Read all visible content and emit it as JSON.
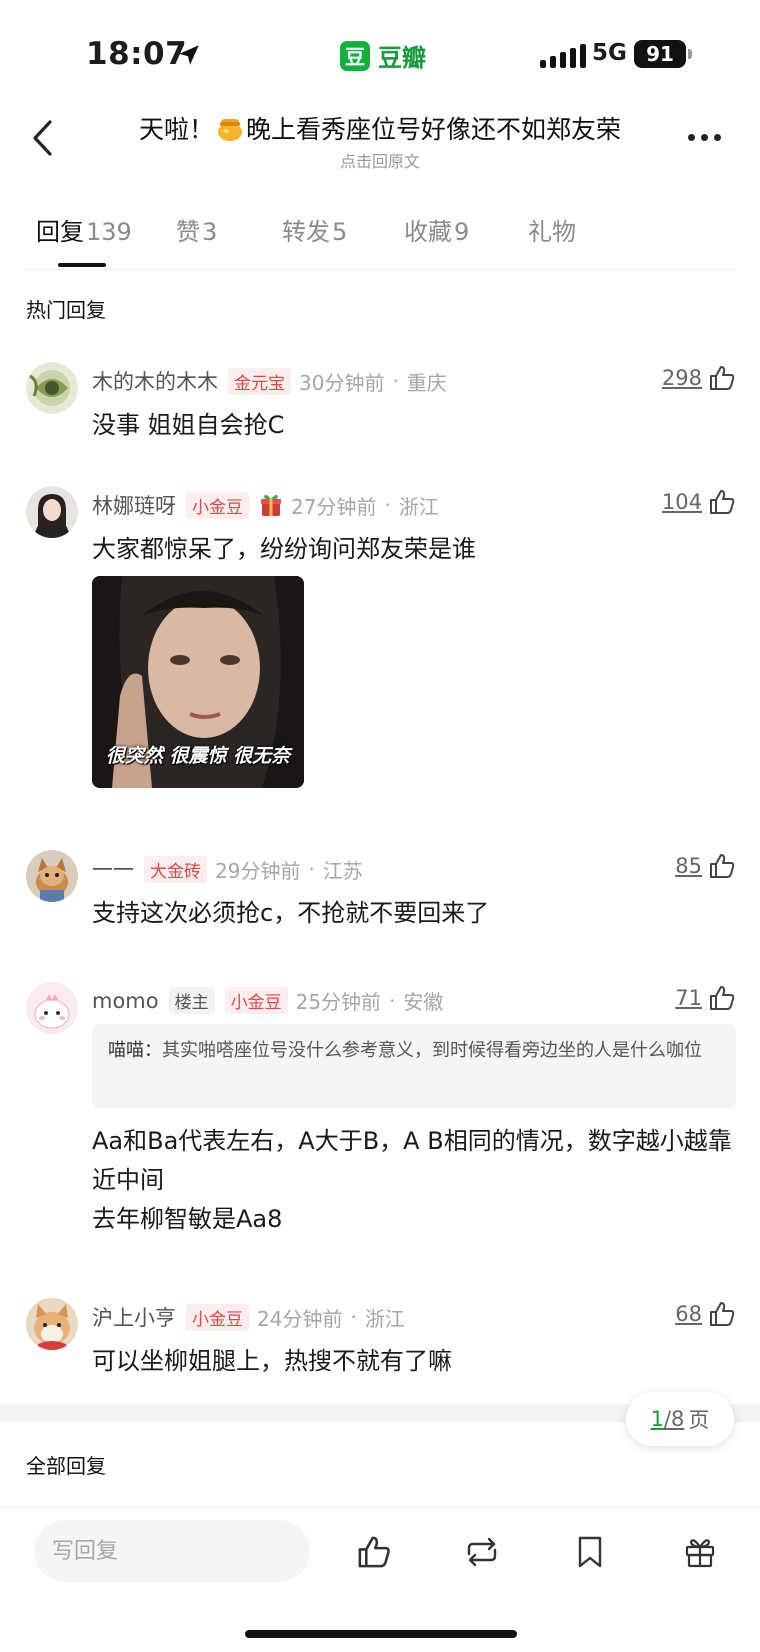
{
  "status_bar": {
    "time": "18:07",
    "app_badge": "豆",
    "app_name": "豆瓣",
    "network": "5G",
    "battery": "91"
  },
  "header": {
    "title_before": "天啦！",
    "title_after": "晚上看秀座位号好像还不如郑友荣",
    "subtitle": "点击回原文"
  },
  "tabs": [
    {
      "label": "回复",
      "count": "139",
      "active": true
    },
    {
      "label": "赞",
      "count": "3"
    },
    {
      "label": "转发",
      "count": "5"
    },
    {
      "label": "收藏",
      "count": "9"
    },
    {
      "label": "礼物",
      "count": ""
    }
  ],
  "hot_section_title": "热门回复",
  "comments": [
    {
      "name": "木的木的木木",
      "badge": "金元宝",
      "time": "30分钟前",
      "location": "重庆",
      "likes": "298",
      "text": "没事 姐姐自会抢C"
    },
    {
      "name": "林娜琏呀",
      "badge": "小金豆",
      "time": "27分钟前",
      "location": "浙江",
      "likes": "104",
      "text": "大家都惊呆了，纷纷询问郑友荣是谁",
      "image_caption": "很突然 很震惊 很无奈"
    },
    {
      "name": "一一",
      "badge": "大金砖",
      "time": "29分钟前",
      "location": "江苏",
      "likes": "85",
      "text": "支持这次必须抢c，不抢就不要回来了"
    },
    {
      "name": "momo",
      "host_badge": "楼主",
      "badge": "小金豆",
      "time": "25分钟前",
      "location": "安徽",
      "likes": "71",
      "quote_name": "喵喵：",
      "quote_text": "其实啪嗒座位号没什么参考意义，到时候得看旁边坐的人是什么咖位",
      "text_lines": [
        "Aa和Ba代表左右，A大于B，A B相同的情况，数字越小越靠近中间",
        "去年柳智敏是Aa8"
      ]
    },
    {
      "name": "沪上小亨",
      "badge": "小金豆",
      "time": "24分钟前",
      "location": "浙江",
      "likes": "68",
      "text": "可以坐柳姐腿上，热搜不就有了嘛"
    }
  ],
  "all_section_title": "全部回复",
  "pager": {
    "current": "1",
    "total": "/8",
    "unit": "页"
  },
  "bottom_bar": {
    "reply_placeholder": "写回复"
  },
  "colors": {
    "brand_green": "#1a9a3c",
    "badge_red": "#e0474c"
  }
}
